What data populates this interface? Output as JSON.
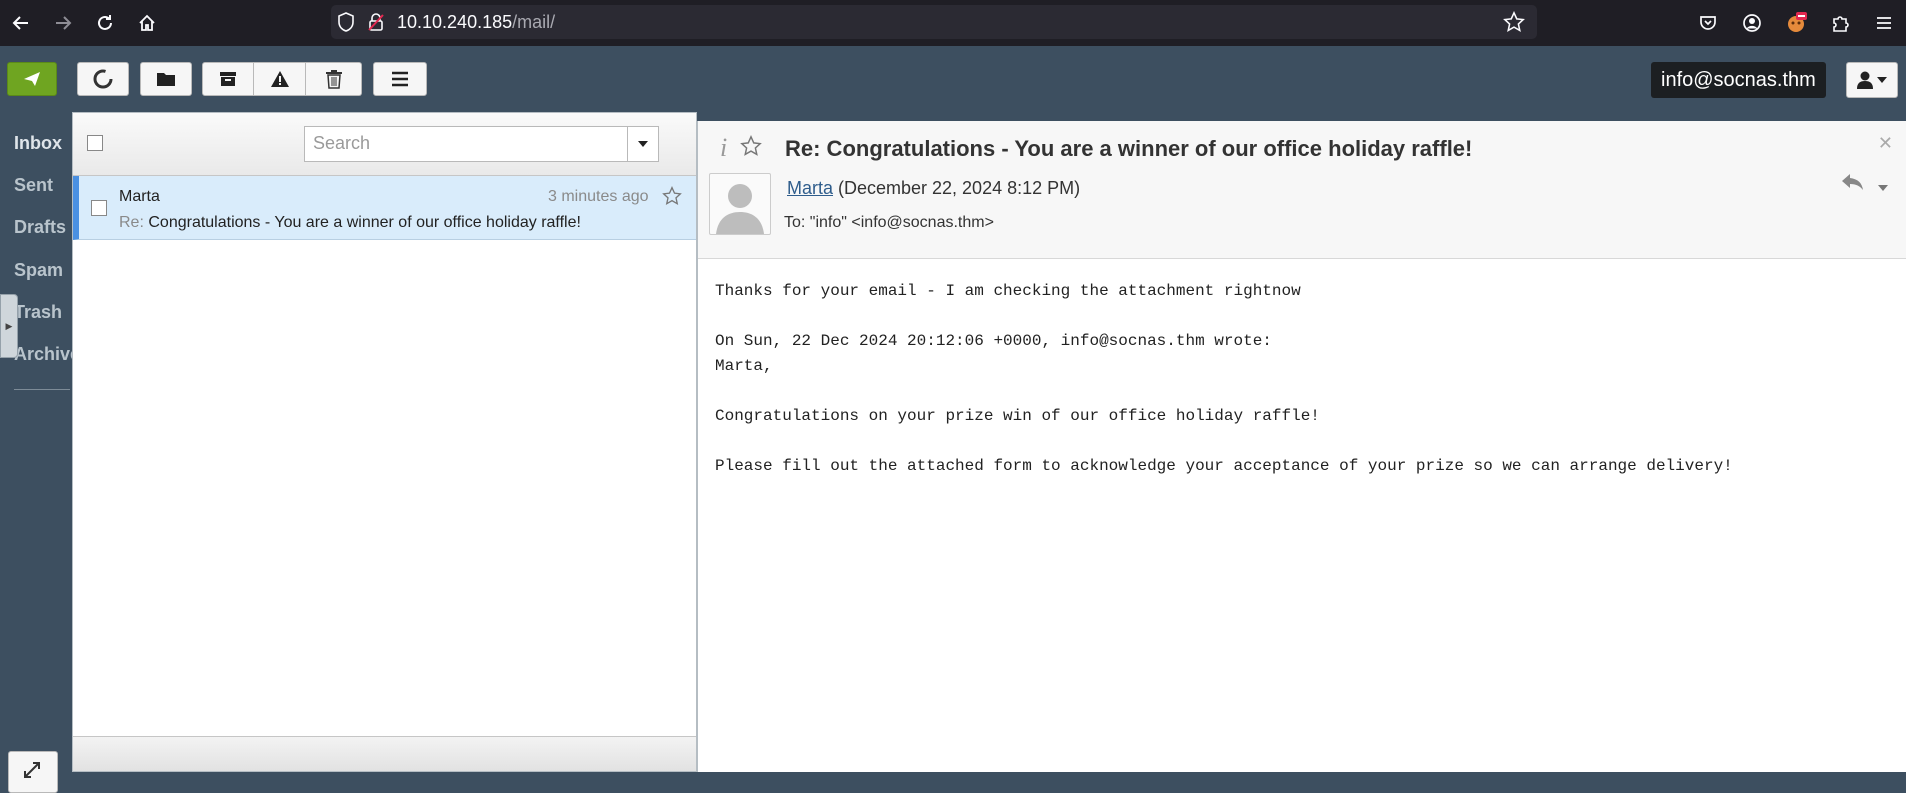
{
  "browser": {
    "url_host": "10.10.240.185",
    "url_path": "/mail/",
    "icons": [
      "back-icon",
      "forward-icon",
      "reload-icon",
      "home-icon",
      "shield-icon",
      "insecure-lock-icon",
      "bookmark-star-icon",
      "pocket-icon",
      "account-icon",
      "extension-icon",
      "extensions-puzzle-icon",
      "menu-icon"
    ]
  },
  "toolbar": {
    "buttons": [
      "compose",
      "refresh",
      "move",
      "archive",
      "spam",
      "delete",
      "more"
    ],
    "account": "info@socnas.thm"
  },
  "sidebar": {
    "folders": [
      {
        "label": "Inbox",
        "active": true
      },
      {
        "label": "Sent",
        "active": false
      },
      {
        "label": "Drafts",
        "active": false
      },
      {
        "label": "Spam",
        "active": false
      },
      {
        "label": "Trash",
        "active": false
      },
      {
        "label": "Archive",
        "active": false
      }
    ]
  },
  "list": {
    "search_placeholder": "Search",
    "messages": [
      {
        "from": "Marta",
        "time": "3 minutes ago",
        "subject_prefix": "Re:",
        "subject": "Congratulations - You are a winner of our office holiday raffle!"
      }
    ]
  },
  "message": {
    "title": "Re: Congratulations - You are a winner of our office holiday raffle!",
    "from": "Marta",
    "date": "(December 22, 2024 8:12 PM)",
    "to": "To: \"info\" <info@socnas.thm>",
    "body": [
      "Thanks for your email - I am checking the attachment rightnow",
      "",
      "On Sun, 22 Dec 2024 20:12:06 +0000, info@socnas.thm wrote:",
      "Marta,",
      "",
      "Congratulations on your prize win of our office holiday raffle!",
      "",
      "Please fill out the attached form to acknowledge your acceptance of your prize so we can arrange delivery!"
    ]
  },
  "colors": {
    "accent_green": "#6fa521",
    "selected_row": "#d9ecfb",
    "selected_border": "#4a90e2",
    "link": "#2f5d8c"
  }
}
